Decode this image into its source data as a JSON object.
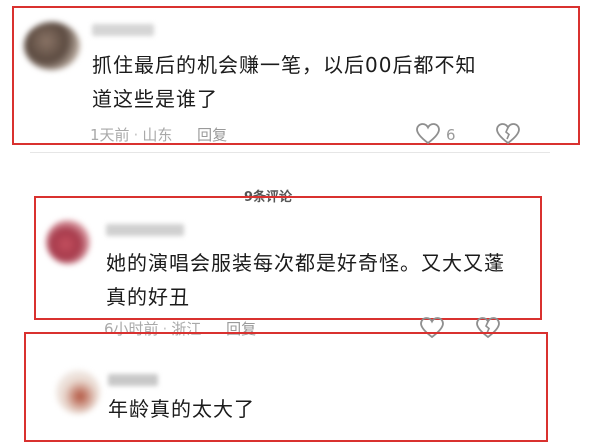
{
  "comments": [
    {
      "text_line1": "抓住最后的机会赚一笔，以后00后都不知",
      "text_line2": "道这些是谁了",
      "time": "1天前",
      "location": "山东",
      "reply_label": "回复",
      "likes": "6"
    },
    {
      "text_line1": "她的演唱会服装每次都是好奇怪。又大又蓬",
      "text_line2": "真的好丑",
      "time": "6小时前",
      "location": "浙江",
      "reply_label": "回复",
      "likes": ""
    },
    {
      "text_line1": "年龄真的太大了"
    }
  ],
  "section": {
    "comment_count_title": "9条评论"
  },
  "separator": "·",
  "colors": {
    "highlight_border": "#d9312f",
    "meta_text": "#a9a9a9"
  },
  "icons": {
    "like": "heart-outline-icon",
    "dislike": "broken-heart-icon"
  }
}
